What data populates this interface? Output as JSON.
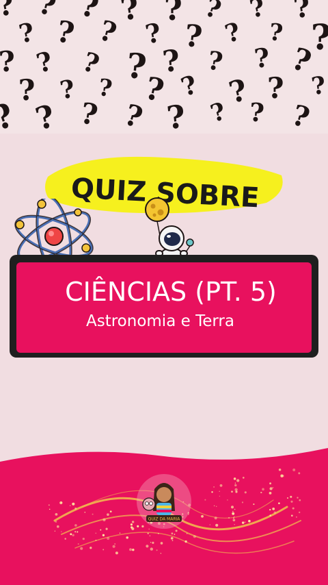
{
  "banner": {
    "title": "QUIZ SOBRE"
  },
  "card": {
    "title": "CIÊNCIAS (PT. 5)",
    "subtitle": "Astronomia e Terra"
  },
  "logo": {
    "text": "QUIZ DA MARIA"
  },
  "colors": {
    "background": "#f1dde1",
    "accent_pink": "#e8115e",
    "banner_yellow": "#f6f01e",
    "card_border": "#1f1f1f",
    "glitter": "#f2c14e"
  },
  "icons": [
    "question-mark-pattern",
    "atom-icon",
    "astronaut-icon",
    "moon-balloon-icon",
    "glitter-swirl"
  ]
}
